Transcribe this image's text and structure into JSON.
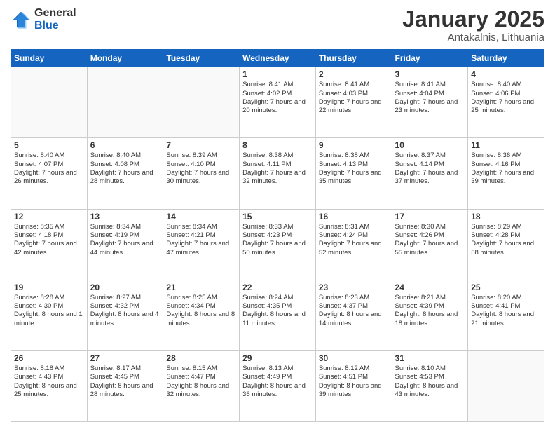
{
  "logo": {
    "general": "General",
    "blue": "Blue"
  },
  "header": {
    "month": "January 2025",
    "location": "Antakalnis, Lithuania"
  },
  "weekdays": [
    "Sunday",
    "Monday",
    "Tuesday",
    "Wednesday",
    "Thursday",
    "Friday",
    "Saturday"
  ],
  "weeks": [
    [
      {
        "day": "",
        "info": ""
      },
      {
        "day": "",
        "info": ""
      },
      {
        "day": "",
        "info": ""
      },
      {
        "day": "1",
        "info": "Sunrise: 8:41 AM\nSunset: 4:02 PM\nDaylight: 7 hours\nand 20 minutes."
      },
      {
        "day": "2",
        "info": "Sunrise: 8:41 AM\nSunset: 4:03 PM\nDaylight: 7 hours\nand 22 minutes."
      },
      {
        "day": "3",
        "info": "Sunrise: 8:41 AM\nSunset: 4:04 PM\nDaylight: 7 hours\nand 23 minutes."
      },
      {
        "day": "4",
        "info": "Sunrise: 8:40 AM\nSunset: 4:06 PM\nDaylight: 7 hours\nand 25 minutes."
      }
    ],
    [
      {
        "day": "5",
        "info": "Sunrise: 8:40 AM\nSunset: 4:07 PM\nDaylight: 7 hours\nand 26 minutes."
      },
      {
        "day": "6",
        "info": "Sunrise: 8:40 AM\nSunset: 4:08 PM\nDaylight: 7 hours\nand 28 minutes."
      },
      {
        "day": "7",
        "info": "Sunrise: 8:39 AM\nSunset: 4:10 PM\nDaylight: 7 hours\nand 30 minutes."
      },
      {
        "day": "8",
        "info": "Sunrise: 8:38 AM\nSunset: 4:11 PM\nDaylight: 7 hours\nand 32 minutes."
      },
      {
        "day": "9",
        "info": "Sunrise: 8:38 AM\nSunset: 4:13 PM\nDaylight: 7 hours\nand 35 minutes."
      },
      {
        "day": "10",
        "info": "Sunrise: 8:37 AM\nSunset: 4:14 PM\nDaylight: 7 hours\nand 37 minutes."
      },
      {
        "day": "11",
        "info": "Sunrise: 8:36 AM\nSunset: 4:16 PM\nDaylight: 7 hours\nand 39 minutes."
      }
    ],
    [
      {
        "day": "12",
        "info": "Sunrise: 8:35 AM\nSunset: 4:18 PM\nDaylight: 7 hours\nand 42 minutes."
      },
      {
        "day": "13",
        "info": "Sunrise: 8:34 AM\nSunset: 4:19 PM\nDaylight: 7 hours\nand 44 minutes."
      },
      {
        "day": "14",
        "info": "Sunrise: 8:34 AM\nSunset: 4:21 PM\nDaylight: 7 hours\nand 47 minutes."
      },
      {
        "day": "15",
        "info": "Sunrise: 8:33 AM\nSunset: 4:23 PM\nDaylight: 7 hours\nand 50 minutes."
      },
      {
        "day": "16",
        "info": "Sunrise: 8:31 AM\nSunset: 4:24 PM\nDaylight: 7 hours\nand 52 minutes."
      },
      {
        "day": "17",
        "info": "Sunrise: 8:30 AM\nSunset: 4:26 PM\nDaylight: 7 hours\nand 55 minutes."
      },
      {
        "day": "18",
        "info": "Sunrise: 8:29 AM\nSunset: 4:28 PM\nDaylight: 7 hours\nand 58 minutes."
      }
    ],
    [
      {
        "day": "19",
        "info": "Sunrise: 8:28 AM\nSunset: 4:30 PM\nDaylight: 8 hours\nand 1 minute."
      },
      {
        "day": "20",
        "info": "Sunrise: 8:27 AM\nSunset: 4:32 PM\nDaylight: 8 hours\nand 4 minutes."
      },
      {
        "day": "21",
        "info": "Sunrise: 8:25 AM\nSunset: 4:34 PM\nDaylight: 8 hours\nand 8 minutes."
      },
      {
        "day": "22",
        "info": "Sunrise: 8:24 AM\nSunset: 4:35 PM\nDaylight: 8 hours\nand 11 minutes."
      },
      {
        "day": "23",
        "info": "Sunrise: 8:23 AM\nSunset: 4:37 PM\nDaylight: 8 hours\nand 14 minutes."
      },
      {
        "day": "24",
        "info": "Sunrise: 8:21 AM\nSunset: 4:39 PM\nDaylight: 8 hours\nand 18 minutes."
      },
      {
        "day": "25",
        "info": "Sunrise: 8:20 AM\nSunset: 4:41 PM\nDaylight: 8 hours\nand 21 minutes."
      }
    ],
    [
      {
        "day": "26",
        "info": "Sunrise: 8:18 AM\nSunset: 4:43 PM\nDaylight: 8 hours\nand 25 minutes."
      },
      {
        "day": "27",
        "info": "Sunrise: 8:17 AM\nSunset: 4:45 PM\nDaylight: 8 hours\nand 28 minutes."
      },
      {
        "day": "28",
        "info": "Sunrise: 8:15 AM\nSunset: 4:47 PM\nDaylight: 8 hours\nand 32 minutes."
      },
      {
        "day": "29",
        "info": "Sunrise: 8:13 AM\nSunset: 4:49 PM\nDaylight: 8 hours\nand 36 minutes."
      },
      {
        "day": "30",
        "info": "Sunrise: 8:12 AM\nSunset: 4:51 PM\nDaylight: 8 hours\nand 39 minutes."
      },
      {
        "day": "31",
        "info": "Sunrise: 8:10 AM\nSunset: 4:53 PM\nDaylight: 8 hours\nand 43 minutes."
      },
      {
        "day": "",
        "info": ""
      }
    ]
  ]
}
